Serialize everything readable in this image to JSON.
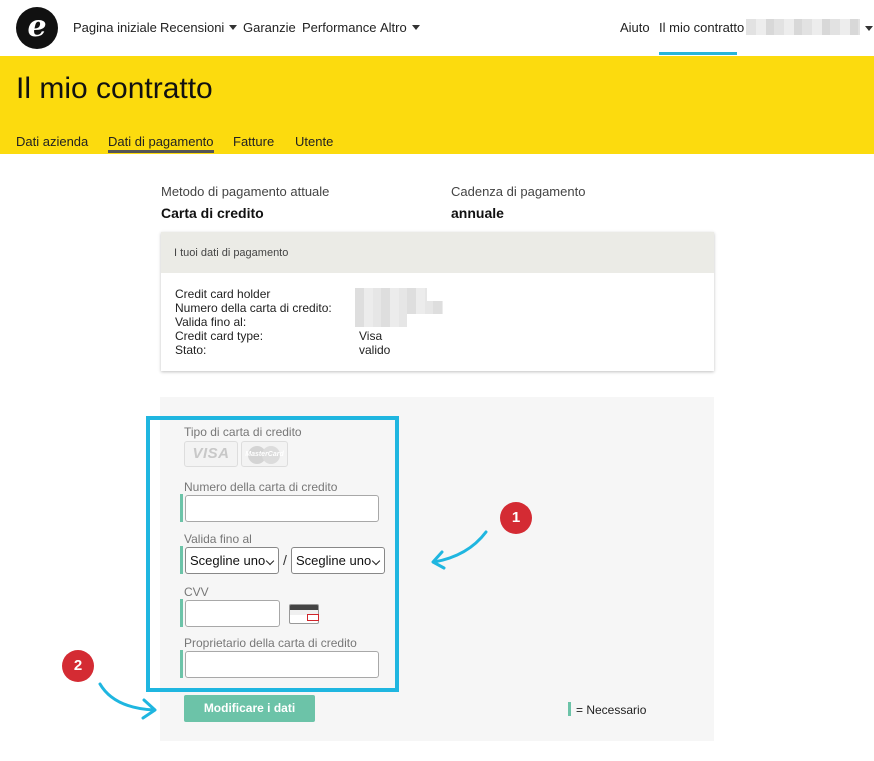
{
  "nav": {
    "logo_letter": "e",
    "items": [
      {
        "label": "Pagina iniziale",
        "dropdown": false
      },
      {
        "label": "Recensioni",
        "dropdown": true
      },
      {
        "label": "Garanzie",
        "dropdown": false
      },
      {
        "label": "Performance",
        "dropdown": false
      },
      {
        "label": "Altro",
        "dropdown": true
      }
    ],
    "help": "Aiuto",
    "my_contract": "Il mio contratto",
    "accent_color": "#29b5d8"
  },
  "header": {
    "title": "Il mio contratto",
    "background": "#fcdb0e",
    "tabs": [
      {
        "label": "Dati azienda",
        "active": false
      },
      {
        "label": "Dati di pagamento",
        "active": true
      },
      {
        "label": "Fatture",
        "active": false
      },
      {
        "label": "Utente",
        "active": false
      }
    ]
  },
  "summary": {
    "method_label": "Metodo di pagamento attuale",
    "method_value": "Carta di credito",
    "cadence_label": "Cadenza di pagamento",
    "cadence_value": "annuale"
  },
  "details": {
    "heading": "I tuoi dati di pagamento",
    "rows": [
      {
        "label": "Credit card holder",
        "value": ""
      },
      {
        "label": "Numero della carta di credito:",
        "value": ""
      },
      {
        "label": "Valida fino al:",
        "value": ""
      },
      {
        "label": "Credit card type:",
        "value": "Visa"
      },
      {
        "label": "Stato:",
        "value": "valido"
      }
    ]
  },
  "form": {
    "card_type_label": "Tipo di carta di credito",
    "visa_logo": "VISA",
    "mastercard_logo": "MasterCard",
    "card_number_label": "Numero della carta di credito",
    "card_number_value": "",
    "expiry_label": "Valida fino al",
    "month_select": "Scegline uno",
    "year_select": "Scegline uno",
    "separator": "/",
    "cvv_label": "CVV",
    "cvv_value": "",
    "holder_label": "Proprietario della carta di credito",
    "holder_value": "",
    "submit_label": "Modificare i dati",
    "required_legend": "= Necessario",
    "required_color": "#6cc3a8"
  },
  "annotations": {
    "badge_1": "1",
    "badge_2": "2",
    "highlight_color": "#1fb6e0",
    "badge_color": "#d42b33"
  }
}
